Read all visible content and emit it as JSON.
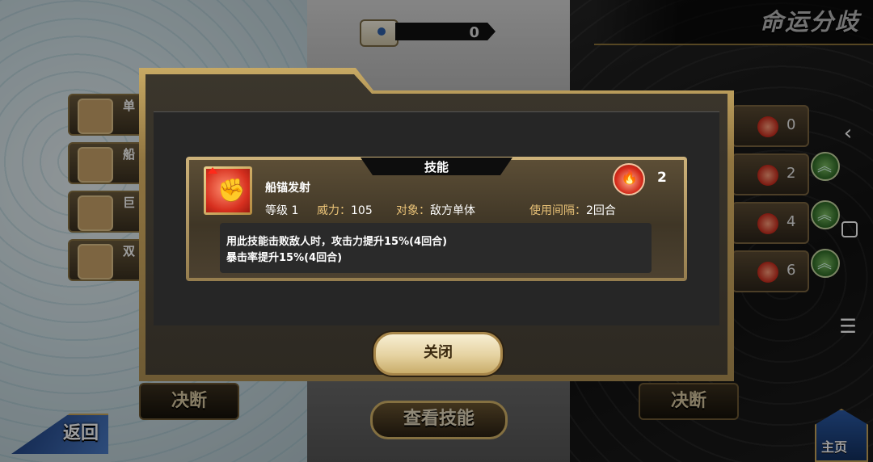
{
  "screen": {
    "title": "命运分歧"
  },
  "scroll_counter": {
    "value": "0"
  },
  "left_list": [
    {
      "label": "单"
    },
    {
      "label": "船"
    },
    {
      "label": "巨"
    },
    {
      "label": "双"
    }
  ],
  "right_list": [
    {
      "value": "0"
    },
    {
      "value": "2"
    },
    {
      "value": "4"
    },
    {
      "value": "6"
    }
  ],
  "bottom": {
    "back_label": "返回",
    "decide_left": "决断",
    "decide_right": "决断",
    "view_skill_label": "查看技能",
    "home_label": "主页"
  },
  "android_nav": {
    "back": "‹",
    "menu": "☰"
  },
  "modal": {
    "header": "技能",
    "skill": {
      "name": "船锚发射",
      "cost": "2",
      "level_label": "等级",
      "level": "1",
      "power_label": "威力：",
      "power": "105",
      "target_label": "对象：",
      "target": "敌方单体",
      "interval_label": "使用间隔：",
      "interval": "2回合",
      "description": [
        "用此技能击败敌人时，攻击力提升15%(4回合)",
        "暴击率提升15%(4回合)"
      ]
    },
    "close_label": "关闭"
  }
}
